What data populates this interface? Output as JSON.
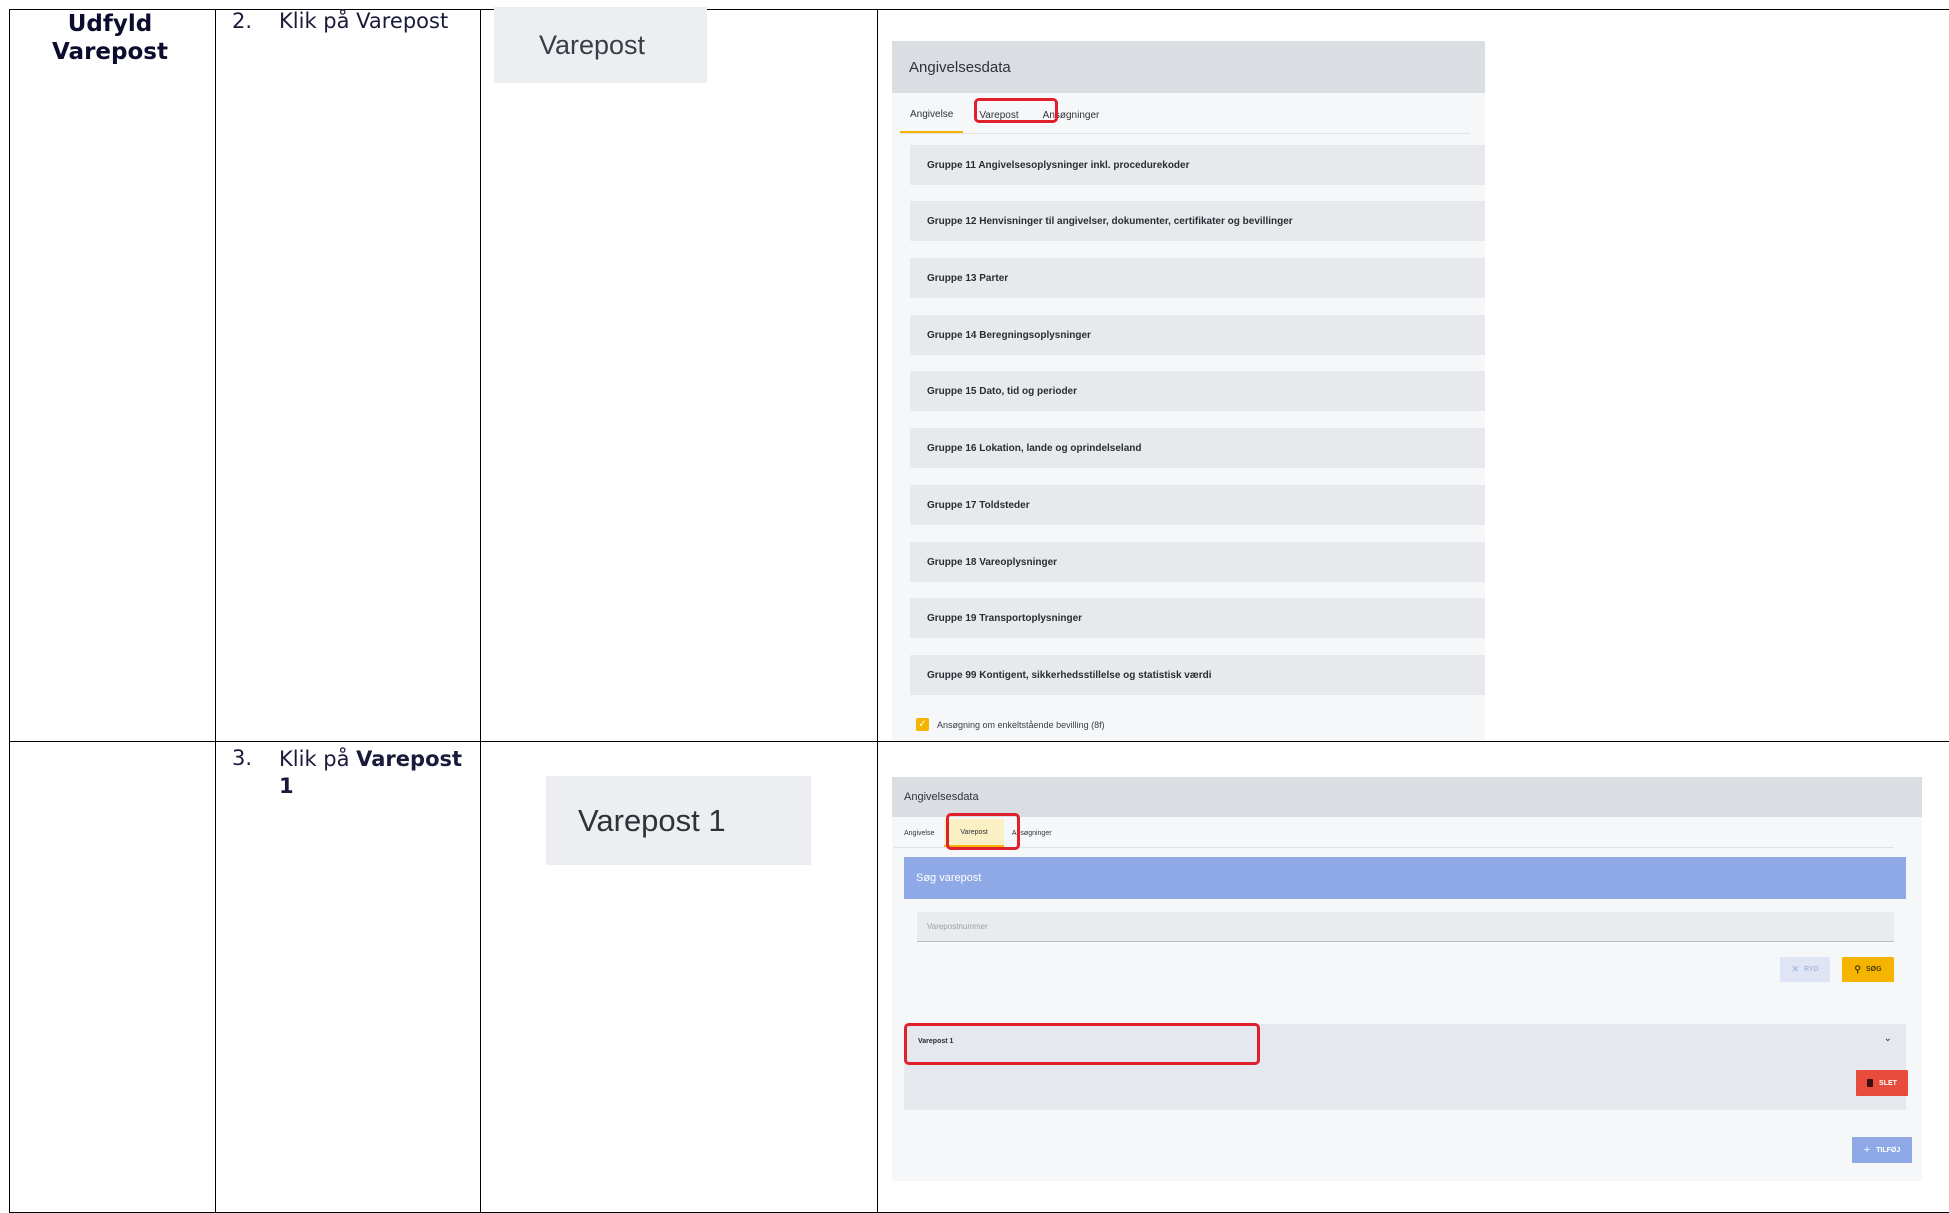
{
  "step_title": "Udfyld Varepost",
  "rows": [
    {
      "number": "2.",
      "instruction": "Klik på Varepost",
      "crop_label": "Varepost",
      "screenshot": {
        "header": "Angivelsesdata",
        "tabs": [
          "Angivelse",
          "Varepost",
          "Ansøgninger"
        ],
        "groups": [
          "Gruppe 11 Angivelsesoplysninger inkl. procedurekoder",
          "Gruppe 12 Henvisninger til angivelser, dokumenter, certifikater og bevillinger",
          "Gruppe 13 Parter",
          "Gruppe 14 Beregningsoplysninger",
          "Gruppe 15 Dato, tid og perioder",
          "Gruppe 16 Lokation, lande og oprindelseland",
          "Gruppe 17 Toldsteder",
          "Gruppe 18 Vareoplysninger",
          "Gruppe 19 Transportoplysninger",
          "Gruppe 99 Kontigent, sikkerhedsstillelse og statistisk værdi"
        ],
        "checkbox_label": "Ansøgning om enkeltstående bevilling (8f)"
      }
    },
    {
      "number": "3.",
      "instruction_prefix": "Klik på ",
      "instruction_bold": "Varepost 1",
      "crop_label": "Varepost 1",
      "screenshot": {
        "header": "Angivelsesdata",
        "tabs": [
          "Angivelse",
          "Varepost",
          "Ansøgninger"
        ],
        "search_title": "Søg varepost",
        "search_placeholder": "Varepostnummer",
        "clear_button": "RYD",
        "search_button": "SØG",
        "item_label": "Varepost 1",
        "delete_button": "SLET",
        "add_button": "TILFØJ"
      }
    }
  ],
  "colors": {
    "highlight": "#e0202a",
    "accent_yellow": "#f5b400",
    "search_blue": "#8ea9e6",
    "delete_red": "#e74c3c"
  }
}
